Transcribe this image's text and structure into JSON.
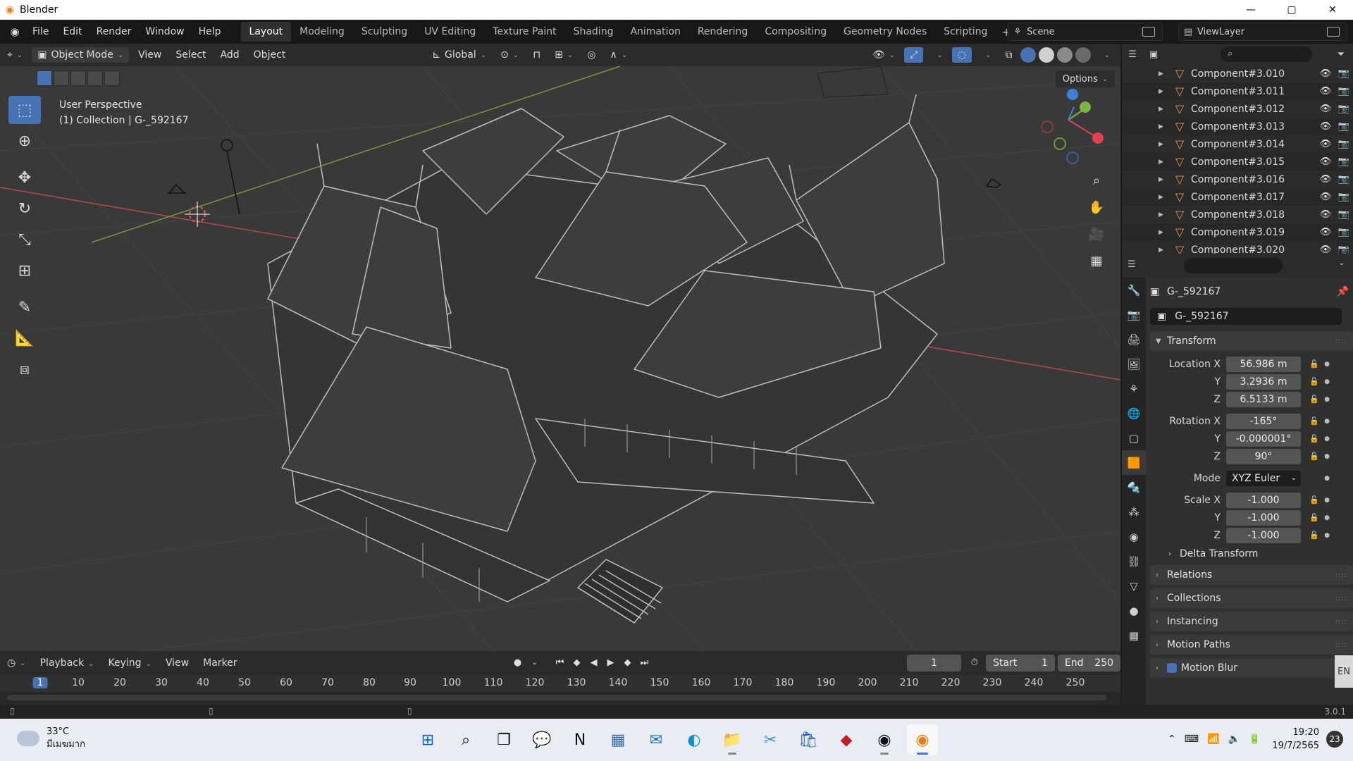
{
  "window": {
    "title": "Blender",
    "minimize": "—",
    "maximize": "▢",
    "close": "✕"
  },
  "menu": {
    "items": [
      "File",
      "Edit",
      "Render",
      "Window",
      "Help"
    ],
    "workspaces": [
      "Layout",
      "Modeling",
      "Sculpting",
      "UV Editing",
      "Texture Paint",
      "Shading",
      "Animation",
      "Rendering",
      "Compositing",
      "Geometry Nodes",
      "Scripting"
    ],
    "active_workspace": "Layout",
    "add_workspace": "+",
    "scene": "Scene",
    "view_layer": "ViewLayer"
  },
  "viewport_header": {
    "mode": "Object Mode",
    "menus": [
      "View",
      "Select",
      "Add",
      "Object"
    ],
    "orientation": "Global",
    "options": "Options"
  },
  "viewport": {
    "perspective": "User Perspective",
    "collection_info": "(1) Collection | G-_592167"
  },
  "toolbar": {
    "tools": [
      "select-box",
      "cursor",
      "move",
      "rotate",
      "scale",
      "transform",
      "annotate",
      "measure",
      "add-cube"
    ]
  },
  "outliner": {
    "items": [
      "Component#3.010",
      "Component#3.011",
      "Component#3.012",
      "Component#3.013",
      "Component#3.014",
      "Component#3.015",
      "Component#3.016",
      "Component#3.017",
      "Component#3.018",
      "Component#3.019",
      "Component#3.020"
    ]
  },
  "properties": {
    "object_name": "G-_592167",
    "data_name": "G-_592167",
    "transform_label": "Transform",
    "location": {
      "label": "Location X",
      "x": "56.986 m",
      "y": "3.2936 m",
      "z": "6.5133 m"
    },
    "rotation": {
      "label": "Rotation X",
      "x": "-165°",
      "y": "-0.000001°",
      "z": "90°"
    },
    "mode_label": "Mode",
    "mode_value": "XYZ Euler",
    "scale": {
      "label": "Scale X",
      "x": "-1.000",
      "y": "-1.000",
      "z": "-1.000"
    },
    "axis_y": "Y",
    "axis_z": "Z",
    "delta_transform": "Delta Transform",
    "panels": [
      "Relations",
      "Collections",
      "Instancing",
      "Motion Paths",
      "Motion Blur"
    ]
  },
  "timeline": {
    "menus": [
      "Playback",
      "Keying",
      "View",
      "Marker"
    ],
    "current_frame": "1",
    "start_label": "Start",
    "start": "1",
    "end_label": "End",
    "end": "250",
    "ruler": [
      "1",
      "10",
      "20",
      "30",
      "40",
      "50",
      "60",
      "70",
      "80",
      "90",
      "100",
      "110",
      "120",
      "130",
      "140",
      "150",
      "160",
      "170",
      "180",
      "190",
      "200",
      "210",
      "220",
      "230",
      "240",
      "250"
    ]
  },
  "statusbar": {
    "version": "3.0.1"
  },
  "taskbar": {
    "weather_temp": "33°C",
    "weather_desc": "มีเมฆมาก",
    "time": "19:20",
    "date": "19/7/2565",
    "notif_count": "23",
    "lang": "EN",
    "apps": [
      "windows-start",
      "search",
      "task-view",
      "teams",
      "notion",
      "calculator",
      "mail",
      "edge",
      "file-explorer",
      "snipping-tool",
      "store",
      "app-red",
      "chrome",
      "blender"
    ]
  },
  "colors": {
    "accent": "#4772b3",
    "viewport_bg": "#393939",
    "axis_x": "#b34a4a",
    "axis_y": "#6f9a3a",
    "gizmo_x": "#e0414a",
    "gizmo_y": "#7cb342",
    "gizmo_z": "#3f7fd9"
  }
}
